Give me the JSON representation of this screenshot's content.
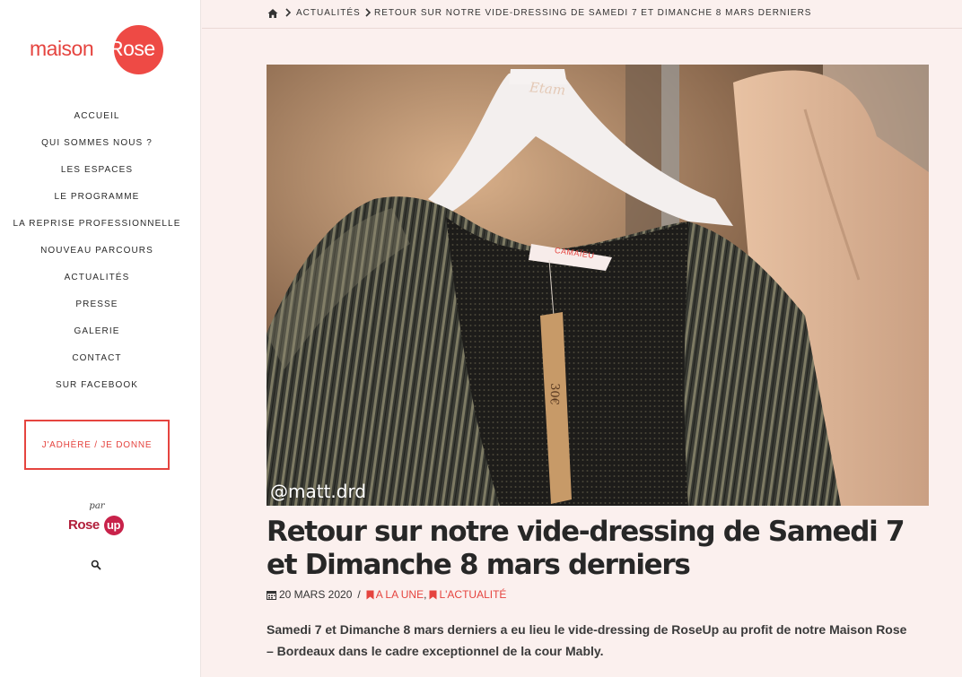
{
  "brand": {
    "name_part1": "maison",
    "name_part2": "Rose",
    "accent_color": "#e5443f"
  },
  "nav": {
    "items": [
      "ACCUEIL",
      "QUI SOMMES NOUS ?",
      "LES ESPACES",
      "LE PROGRAMME",
      "LA REPRISE PROFESSIONNELLE",
      "NOUVEAU PARCOURS",
      "ACTUALITÉS",
      "PRESSE",
      "GALERIE",
      "CONTACT",
      "SUR FACEBOOK"
    ],
    "cta_label": "J'ADHÈRE / JE DONNE",
    "by_label": "par",
    "partner_name_part1": "Rose",
    "partner_name_part2": "up",
    "search_icon": "search-icon"
  },
  "breadcrumb": {
    "home_icon": "home-icon",
    "items": [
      "ACTUALITÉS",
      "RETOUR SUR NOTRE VIDE-DRESSING DE SAMEDI 7 ET DIMANCHE 8 MARS DERNIERS"
    ]
  },
  "article": {
    "photo_credit": "@matt.drd",
    "hanger_brand": "Etam",
    "label_brand": "CAMAÏEU",
    "tag_price": "30€",
    "title": "Retour sur notre vide-dressing de Samedi 7 et Dimanche 8 mars derniers",
    "date": "20 MARS 2020",
    "date_separator": "/",
    "categories": [
      "A LA UNE",
      "L'ACTUALITÉ"
    ],
    "excerpt": "Samedi 7 et Dimanche 8 mars derniers a eu lieu le vide-dressing de RoseUp au profit de notre Maison Rose – Bordeaux dans le cadre exceptionnel de la cour Mably."
  }
}
